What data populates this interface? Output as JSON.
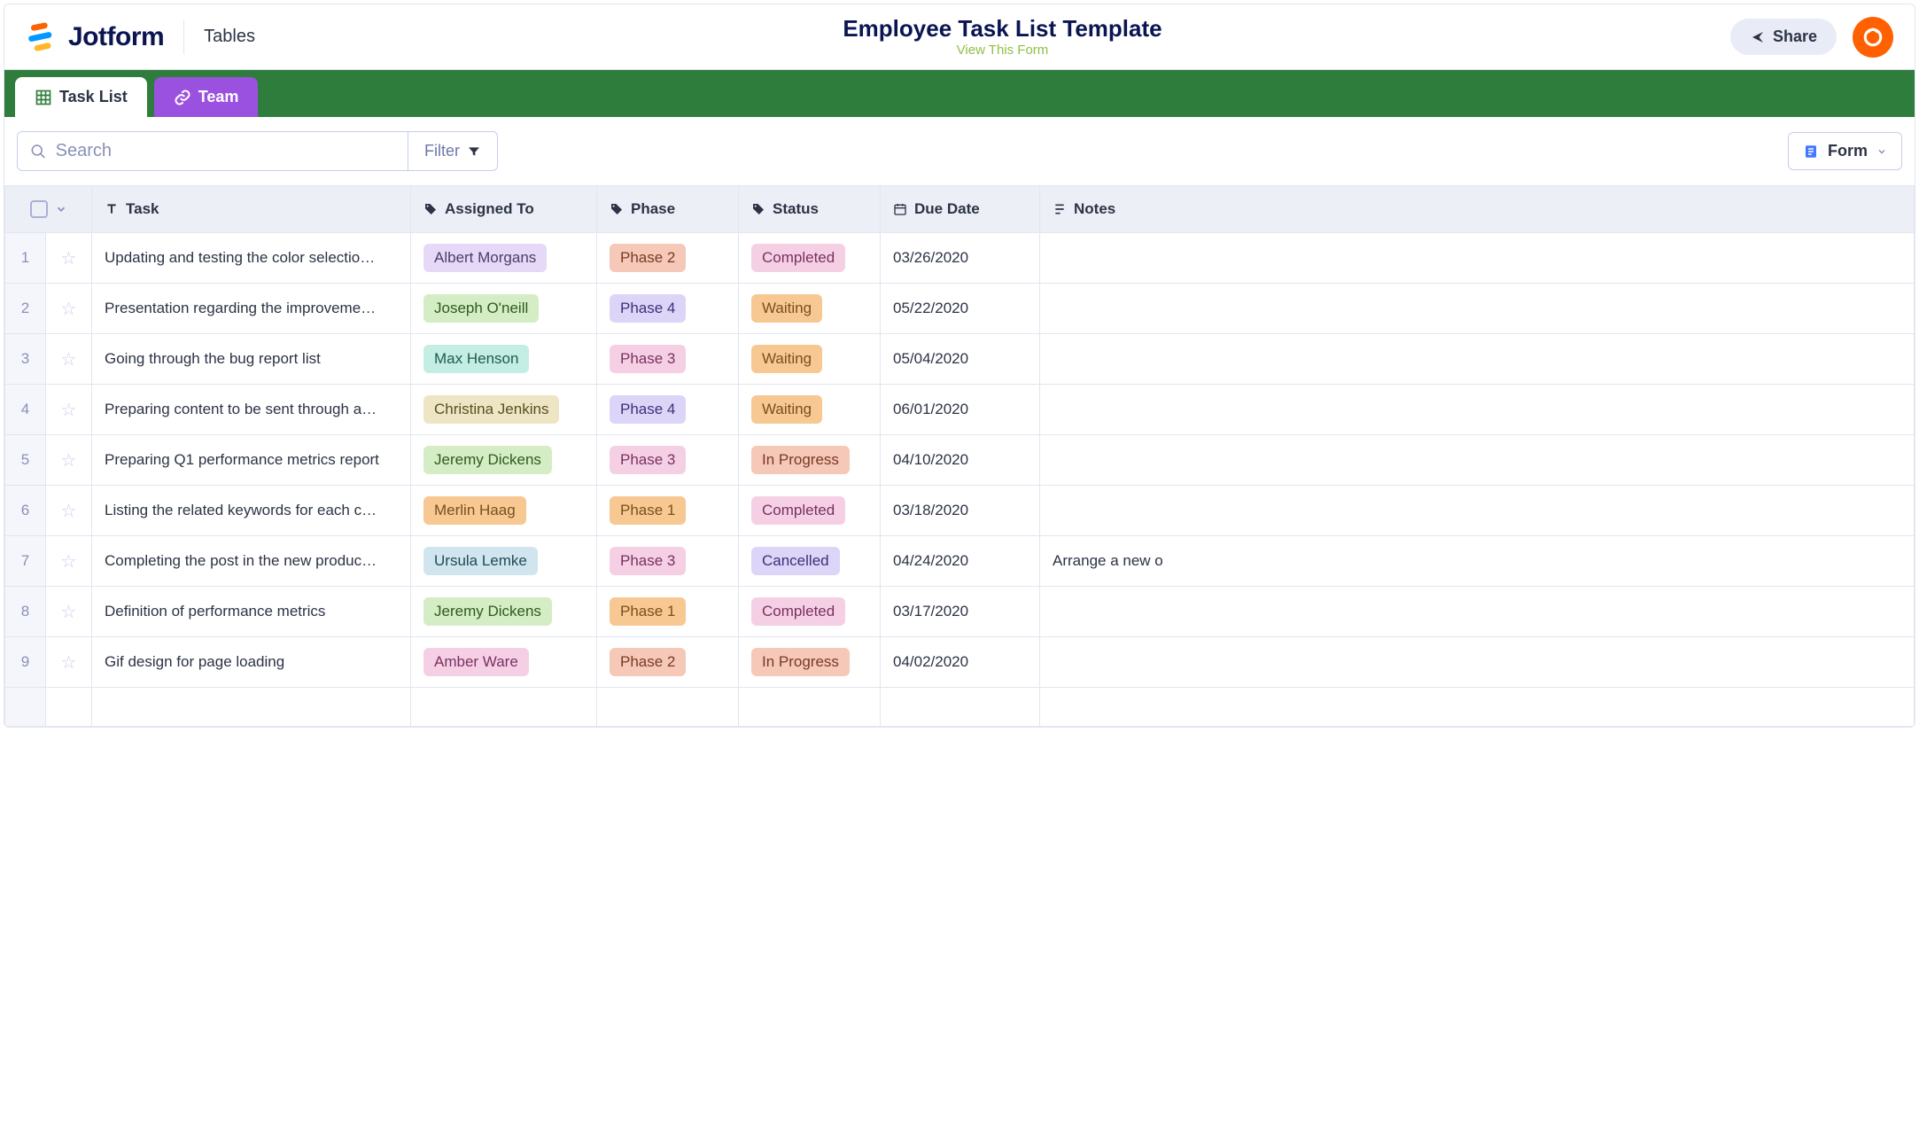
{
  "header": {
    "brand": "Jotform",
    "nav": "Tables",
    "title": "Employee Task List Template",
    "view_link": "View This Form",
    "share": "Share"
  },
  "tabs": [
    {
      "label": "Task List",
      "active": true
    },
    {
      "label": "Team",
      "active": false
    }
  ],
  "toolbar": {
    "search_placeholder": "Search",
    "filter": "Filter",
    "form_btn": "Form"
  },
  "columns": {
    "task": "Task",
    "assigned": "Assigned To",
    "phase": "Phase",
    "status": "Status",
    "due": "Due Date",
    "notes": "Notes"
  },
  "tag_colors": {
    "assigned": {
      "Albert Morgans": "c-purple-light",
      "Joseph O'neill": "c-green-light",
      "Max Henson": "c-teal-light",
      "Christina Jenkins": "c-beige",
      "Jeremy Dickens": "c-green-light",
      "Merlin Haag": "c-orange",
      "Ursula Lemke": "c-blue-light",
      "Amber Ware": "c-pink-light"
    },
    "phase": {
      "Phase 1": "c-orange",
      "Phase 2": "c-salmon",
      "Phase 3": "c-pink-light",
      "Phase 4": "c-lavender"
    },
    "status": {
      "Completed": "c-pink-light",
      "Waiting": "c-orange",
      "In Progress": "c-salmon",
      "Cancelled": "c-lavender"
    }
  },
  "rows": [
    {
      "n": "1",
      "task": "Updating and testing the color selectio…",
      "assigned": "Albert Morgans",
      "phase": "Phase 2",
      "status": "Completed",
      "due": "03/26/2020",
      "notes": ""
    },
    {
      "n": "2",
      "task": "Presentation regarding the improveme…",
      "assigned": "Joseph O'neill",
      "phase": "Phase 4",
      "status": "Waiting",
      "due": "05/22/2020",
      "notes": ""
    },
    {
      "n": "3",
      "task": "Going through the bug report list",
      "assigned": "Max Henson",
      "phase": "Phase 3",
      "status": "Waiting",
      "due": "05/04/2020",
      "notes": ""
    },
    {
      "n": "4",
      "task": "Preparing content to be sent through a…",
      "assigned": "Christina Jenkins",
      "phase": "Phase 4",
      "status": "Waiting",
      "due": "06/01/2020",
      "notes": ""
    },
    {
      "n": "5",
      "task": "Preparing Q1 performance metrics report",
      "assigned": "Jeremy Dickens",
      "phase": "Phase 3",
      "status": "In Progress",
      "due": "04/10/2020",
      "notes": ""
    },
    {
      "n": "6",
      "task": "Listing the related keywords for each c…",
      "assigned": "Merlin Haag",
      "phase": "Phase 1",
      "status": "Completed",
      "due": "03/18/2020",
      "notes": ""
    },
    {
      "n": "7",
      "task": "Completing the post in the new produc…",
      "assigned": "Ursula Lemke",
      "phase": "Phase 3",
      "status": "Cancelled",
      "due": "04/24/2020",
      "notes": "Arrange a new o"
    },
    {
      "n": "8",
      "task": "Definition of performance metrics",
      "assigned": "Jeremy Dickens",
      "phase": "Phase 1",
      "status": "Completed",
      "due": "03/17/2020",
      "notes": ""
    },
    {
      "n": "9",
      "task": "Gif design for page loading",
      "assigned": "Amber Ware",
      "phase": "Phase 2",
      "status": "In Progress",
      "due": "04/02/2020",
      "notes": ""
    }
  ]
}
